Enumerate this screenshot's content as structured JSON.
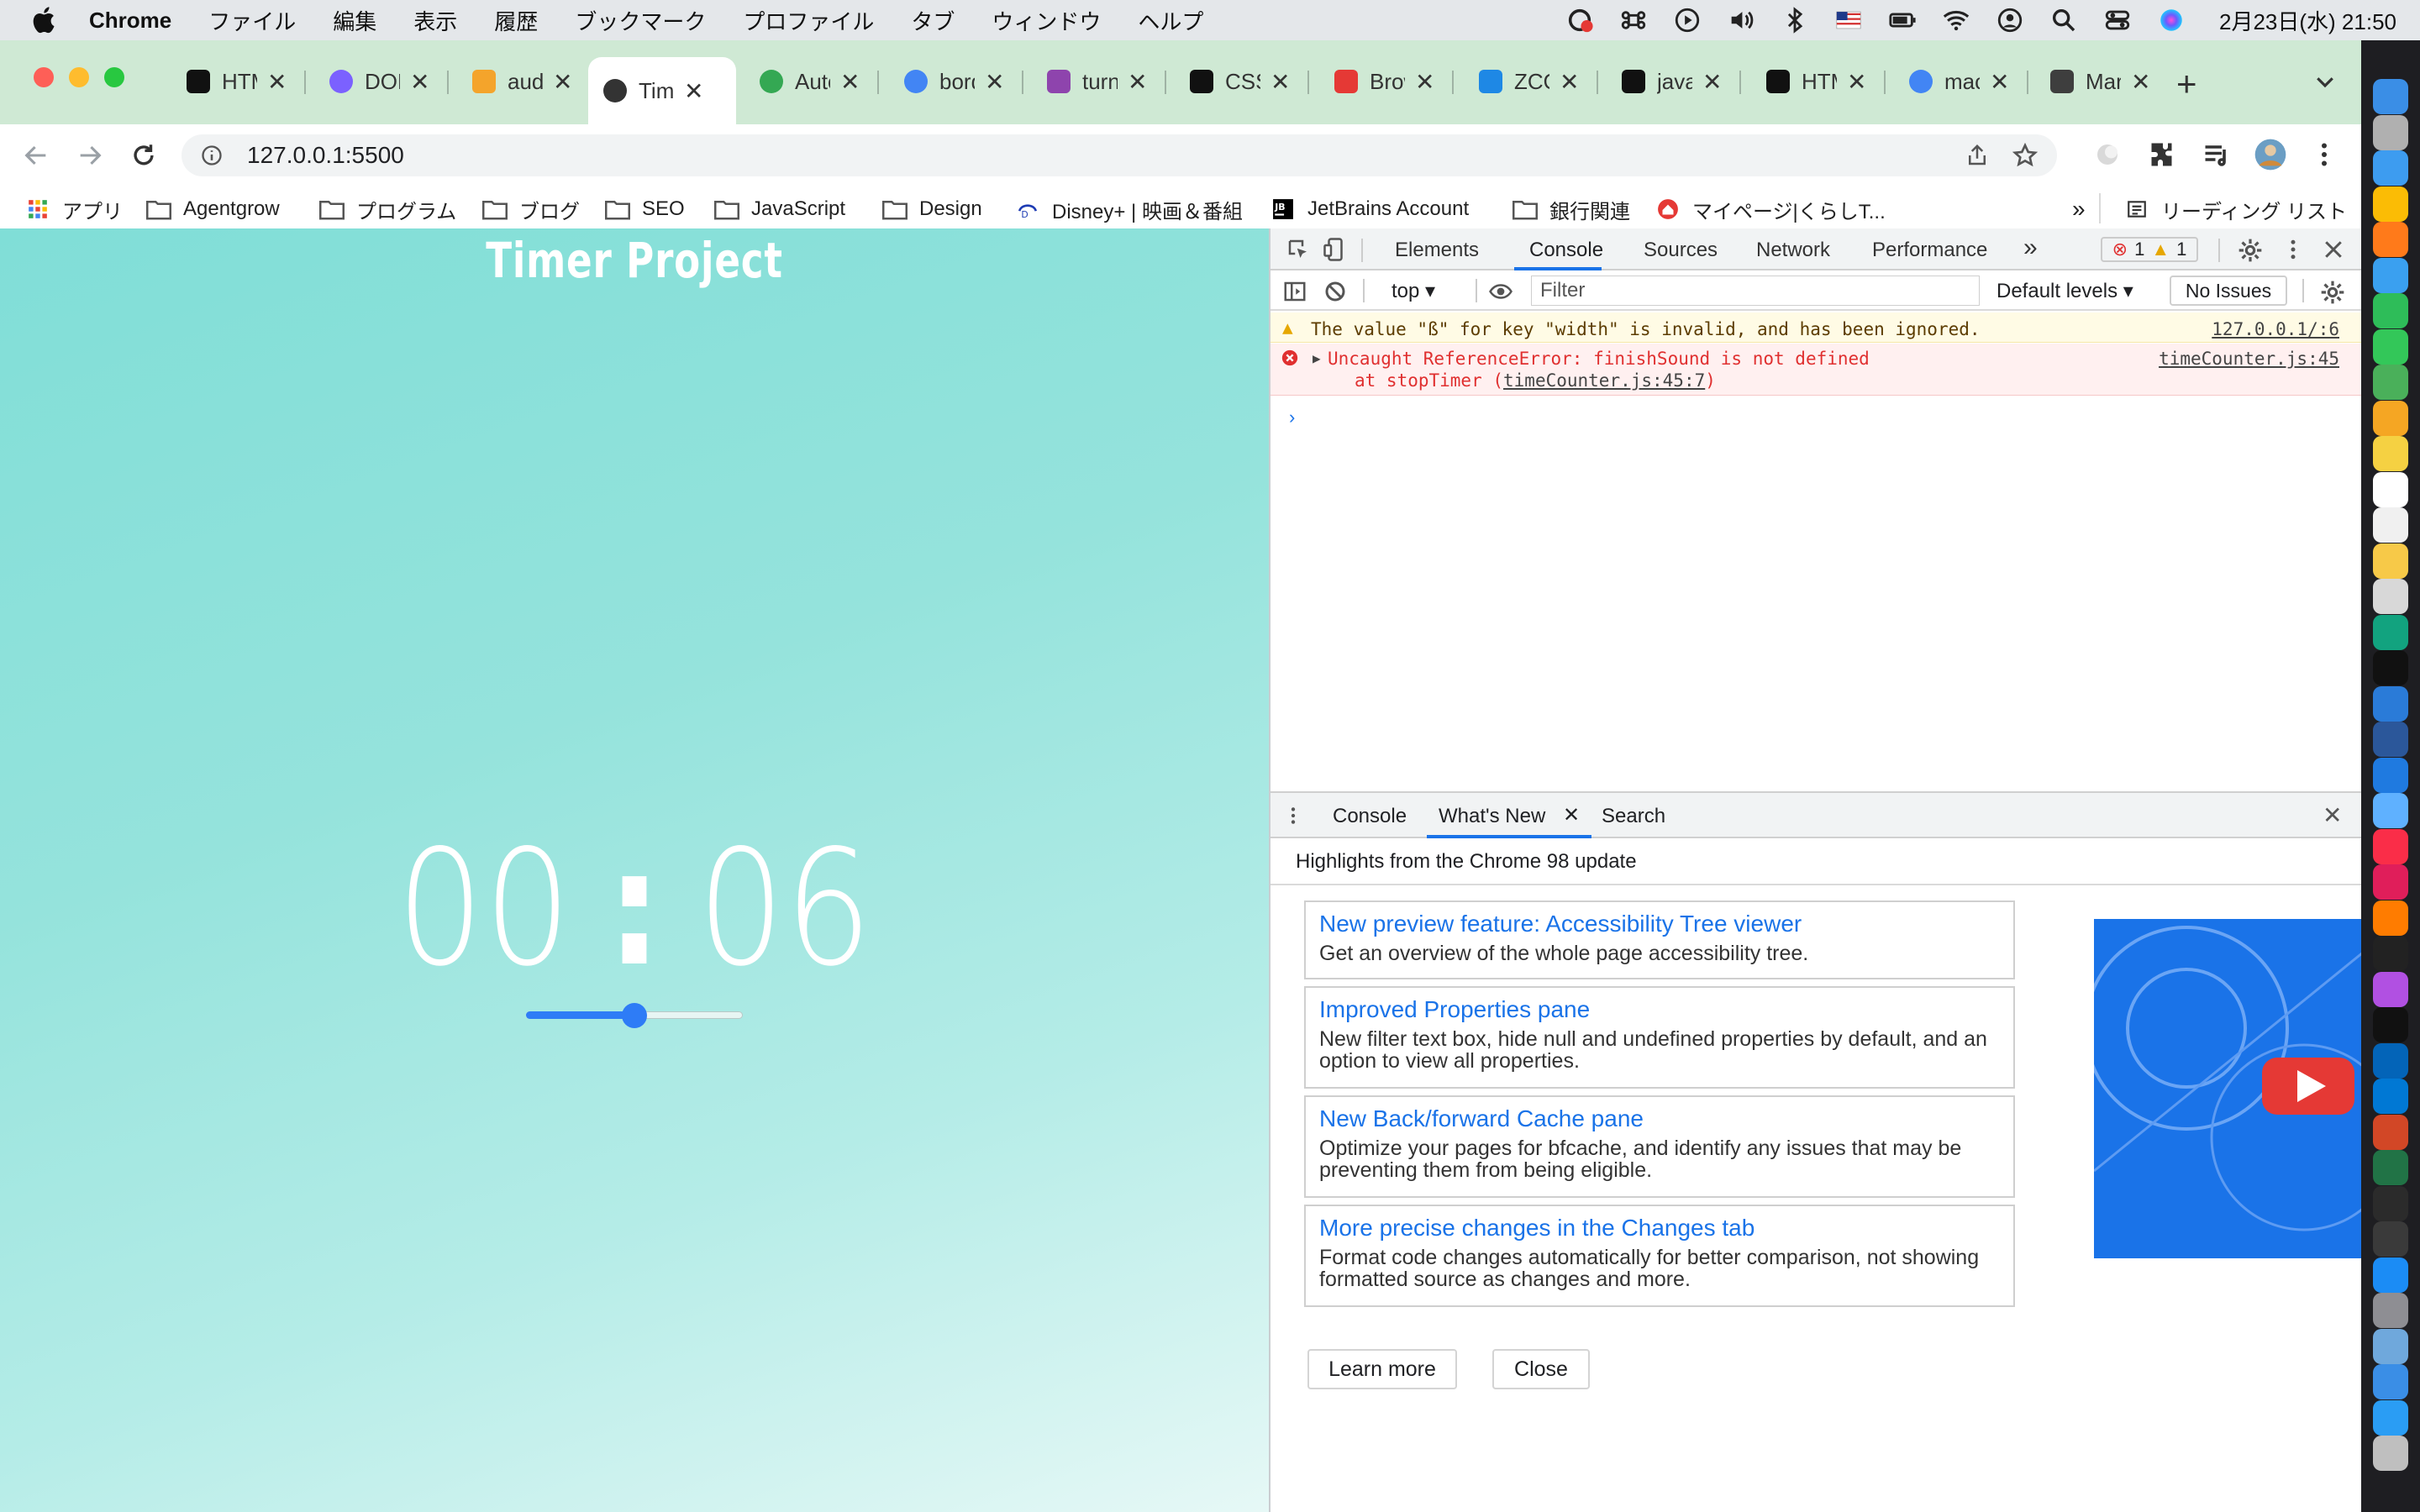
{
  "menubar": {
    "app_name": "Chrome",
    "items": [
      "ファイル",
      "編集",
      "表示",
      "履歴",
      "ブックマーク",
      "プロファイル",
      "タブ",
      "ウィンドウ",
      "ヘルプ"
    ],
    "clock": "2月23日(水) 21:50"
  },
  "tabs": [
    {
      "title": "HTML",
      "favicon": "page-icon",
      "color": "#111111"
    },
    {
      "title": "DOM",
      "favicon": "globe-icon",
      "color": "#7b61ff"
    },
    {
      "title": "audio",
      "favicon": "shapes-icon",
      "color": "#f4a42b"
    },
    {
      "title": "Timer Project",
      "favicon": "globe-icon",
      "color": "#333333",
      "active": true
    },
    {
      "title": "Autoplay",
      "favicon": "chrome-icon",
      "color": "#34a853"
    },
    {
      "title": "border",
      "favicon": "google-icon",
      "color": "#4285f4"
    },
    {
      "title": "turn",
      "favicon": "swirl-icon",
      "color": "#8e44ad"
    },
    {
      "title": "CSS",
      "favicon": "page-icon",
      "color": "#111111"
    },
    {
      "title": "Browser",
      "favicon": "blocks-icon",
      "color": "#e53935"
    },
    {
      "title": "ZCO",
      "favicon": "blocks-icon",
      "color": "#1e88e5"
    },
    {
      "title": "java",
      "favicon": "lambda-icon",
      "color": "#111111"
    },
    {
      "title": "HTML",
      "favicon": "page-icon",
      "color": "#111111"
    },
    {
      "title": "mac",
      "favicon": "google-icon",
      "color": "#4285f4"
    },
    {
      "title": "Mar",
      "favicon": "stripe-icon",
      "color": "#3e3e3e"
    }
  ],
  "address": {
    "url": "127.0.0.1:5500"
  },
  "bookmarks": [
    {
      "label": "アプリ",
      "icon": "apps-grid-icon"
    },
    {
      "label": "Agentgrow",
      "icon": "folder-icon"
    },
    {
      "label": "プログラム",
      "icon": "folder-icon"
    },
    {
      "label": "ブログ",
      "icon": "folder-icon"
    },
    {
      "label": "SEO",
      "icon": "folder-icon"
    },
    {
      "label": "JavaScript",
      "icon": "folder-icon"
    },
    {
      "label": "Design",
      "icon": "folder-icon"
    },
    {
      "label": "Disney+ | 映画＆番組",
      "icon": "disney-icon"
    },
    {
      "label": "JetBrains Account",
      "icon": "jetbrains-icon"
    },
    {
      "label": "銀行関連",
      "icon": "folder-icon"
    },
    {
      "label": "マイページ|くらしT...",
      "icon": "home-badge-icon"
    }
  ],
  "bookmarks_more": "»",
  "reading_list": "リーディング リスト",
  "page": {
    "title": "Timer Project",
    "minutes": "00",
    "colon": ":",
    "seconds": "06",
    "slider_value": 0.5,
    "accent": "#2e7cf6"
  },
  "devtools": {
    "tabs": [
      "Elements",
      "Console",
      "Sources",
      "Network",
      "Performance"
    ],
    "active_tab": "Console",
    "more": "»",
    "error_count": "1",
    "warning_count": "1",
    "context": "top",
    "filter_placeholder": "Filter",
    "levels": "Default levels",
    "issues": "No Issues",
    "warning": {
      "text": "The value \"ß\" for key \"width\" is invalid, and has been ignored.",
      "source": "127.0.0.1/:6"
    },
    "error": {
      "text": "Uncaught ReferenceError: finishSound is not defined",
      "stack_prefix": "at stopTimer (",
      "stack_link": "timeCounter.js:45:7",
      "stack_suffix": ")",
      "source": "timeCounter.js:45"
    },
    "prompt": "›",
    "drawer": {
      "tabs": [
        "Console",
        "What's New",
        "Search"
      ],
      "active_tab": "What's New",
      "heading": "Highlights from the Chrome 98 update",
      "cards": [
        {
          "title": "New preview feature: Accessibility Tree viewer",
          "desc": "Get an overview of the whole page accessibility tree."
        },
        {
          "title": "Improved Properties pane",
          "desc": "New filter text box, hide null and undefined properties by default, and an option to view all properties."
        },
        {
          "title": "New Back/forward Cache pane",
          "desc": "Optimize your pages for bfcache, and identify any issues that may be preventing them from being eligible."
        },
        {
          "title": "More precise changes in the Changes tab",
          "desc": "Format code changes automatically for better comparison, not showing formatted source as changes and more."
        }
      ],
      "learn_more": "Learn more",
      "close": "Close"
    }
  },
  "dock_apps": [
    "finder",
    "launchpad",
    "safari",
    "chrome",
    "firefox",
    "mail",
    "facetime",
    "messages",
    "maps",
    "photos",
    "notes-yellow",
    "calendar",
    "reminders",
    "notes",
    "calculator",
    "chatgpt",
    "jetbrains",
    "vscode",
    "word-blue",
    "xcode",
    "paint",
    "music",
    "slack",
    "illustrator",
    "iterm",
    "podcasts",
    "appletv",
    "onedrive",
    "outlook",
    "powerpoint",
    "excel",
    "terminal",
    "activity",
    "appstore",
    "settings",
    "preview",
    "finder-2",
    "airdrop",
    "trash"
  ]
}
